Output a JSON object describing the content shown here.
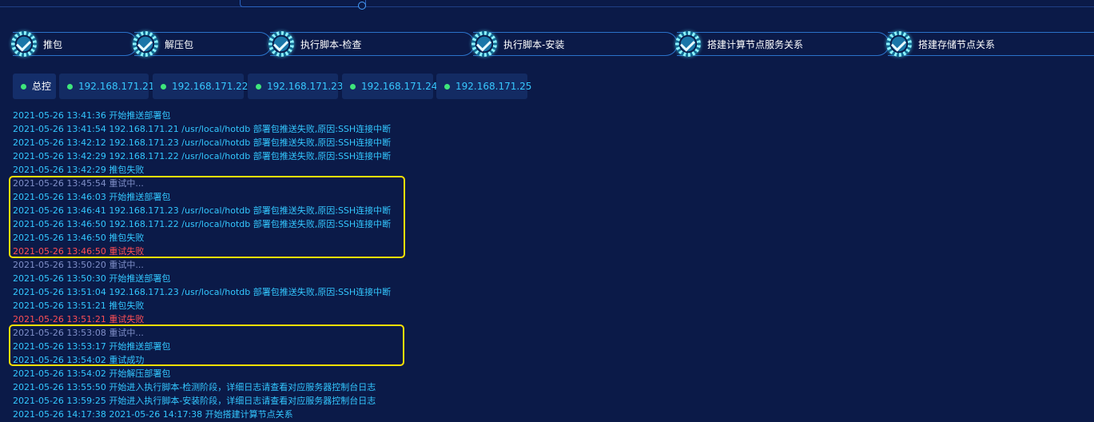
{
  "steps": [
    {
      "label": "推包"
    },
    {
      "label": "解压包"
    },
    {
      "label": "执行脚本-检查"
    },
    {
      "label": "执行脚本-安装"
    },
    {
      "label": "搭建计算节点服务关系"
    },
    {
      "label": "搭建存储节点关系"
    }
  ],
  "tabs": [
    {
      "label": "总控"
    },
    {
      "label": "192.168.171.21"
    },
    {
      "label": "192.168.171.22"
    },
    {
      "label": "192.168.171.23"
    },
    {
      "label": "192.168.171.24"
    },
    {
      "label": "192.168.171.25"
    }
  ],
  "log": [
    {
      "text": "2021-05-26 13:41:36 开始推送部署包",
      "status": "normal"
    },
    {
      "text": "2021-05-26 13:41:54 192.168.171.21 /usr/local/hotdb 部署包推送失败,原因:SSH连接中断",
      "status": "normal"
    },
    {
      "text": "2021-05-26 13:42:12 192.168.171.23 /usr/local/hotdb 部署包推送失败,原因:SSH连接中断",
      "status": "normal"
    },
    {
      "text": "2021-05-26 13:42:29 192.168.171.22 /usr/local/hotdb 部署包推送失败,原因:SSH连接中断",
      "status": "normal"
    },
    {
      "text": "2021-05-26 13:42:29 推包失败",
      "status": "normal"
    },
    {
      "text": "2021-05-26 13:45:54 重试中...",
      "status": "retry"
    },
    {
      "text": "2021-05-26 13:46:03 开始推送部署包",
      "status": "normal"
    },
    {
      "text": "2021-05-26 13:46:41 192.168.171.23 /usr/local/hotdb 部署包推送失败,原因:SSH连接中断",
      "status": "normal"
    },
    {
      "text": "2021-05-26 13:46:50 192.168.171.22 /usr/local/hotdb 部署包推送失败,原因:SSH连接中断",
      "status": "normal"
    },
    {
      "text": "2021-05-26 13:46:50 推包失败",
      "status": "normal"
    },
    {
      "text": "2021-05-26 13:46:50 重试失败",
      "status": "fail"
    },
    {
      "text": "2021-05-26 13:50:20 重试中...",
      "status": "retry"
    },
    {
      "text": "2021-05-26 13:50:30 开始推送部署包",
      "status": "normal"
    },
    {
      "text": "2021-05-26 13:51:04 192.168.171.23 /usr/local/hotdb 部署包推送失败,原因:SSH连接中断",
      "status": "normal"
    },
    {
      "text": "2021-05-26 13:51:21 推包失败",
      "status": "normal"
    },
    {
      "text": "2021-05-26 13:51:21 重试失败",
      "status": "fail"
    },
    {
      "text": "2021-05-26 13:53:08 重试中...",
      "status": "retry"
    },
    {
      "text": "2021-05-26 13:53:17 开始推送部署包",
      "status": "normal"
    },
    {
      "text": "2021-05-26 13:54:02 重试成功",
      "status": "normal"
    },
    {
      "text": "2021-05-26 13:54:02 开始解压部署包",
      "status": "normal"
    },
    {
      "text": "2021-05-26 13:55:50 开始进入执行脚本-检测阶段，详细日志请查看对应服务器控制台日志",
      "status": "normal"
    },
    {
      "text": "2021-05-26 13:59:25 开始进入执行脚本-安装阶段，详细日志请查看对应服务器控制台日志",
      "status": "normal"
    },
    {
      "text": "2021-05-26 14:17:38 2021-05-26 14:17:38 开始搭建计算节点关系",
      "status": "normal"
    }
  ],
  "colors": {
    "background": "#0b1a48",
    "log_normal": "#33c7ff",
    "log_retry": "#7f8fc8",
    "log_fail": "#ff4f55",
    "highlight": "#ffe000",
    "tab_dot": "#3ee67b"
  }
}
